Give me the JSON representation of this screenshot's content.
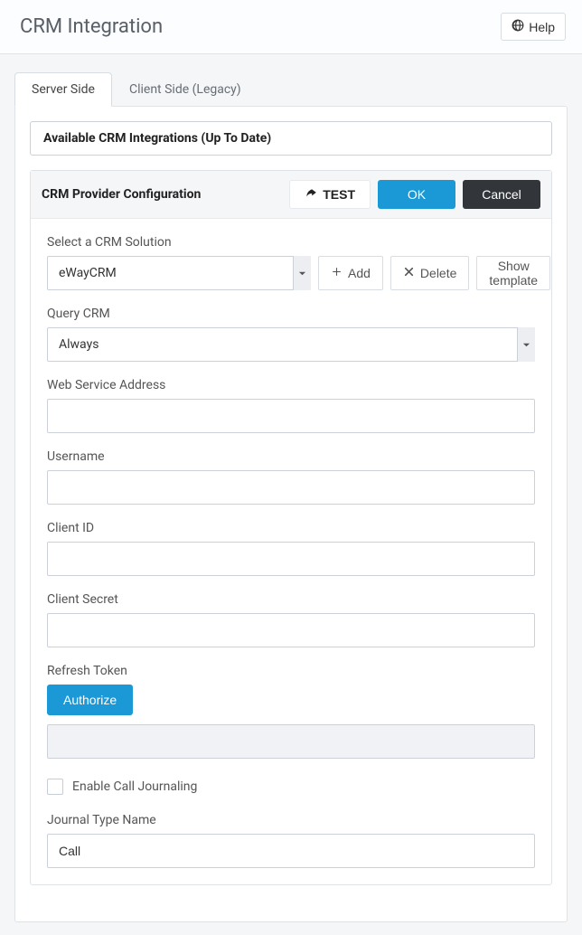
{
  "header": {
    "title": "CRM Integration",
    "help_label": "Help"
  },
  "tabs": {
    "server_side": "Server Side",
    "client_side": "Client Side (Legacy)"
  },
  "available_bar": "Available CRM Integrations (Up To Date)",
  "config": {
    "title": "CRM Provider Configuration",
    "test_label": "TEST",
    "ok_label": "OK",
    "cancel_label": "Cancel"
  },
  "fields": {
    "select_crm_label": "Select a CRM Solution",
    "crm_selected": "eWayCRM",
    "add_label": "Add",
    "delete_label": "Delete",
    "show_template_label": "Show template",
    "query_crm_label": "Query CRM",
    "query_crm_value": "Always",
    "web_service_label": "Web Service Address",
    "web_service_value": "",
    "username_label": "Username",
    "username_value": "",
    "client_id_label": "Client ID",
    "client_id_value": "",
    "client_secret_label": "Client Secret",
    "client_secret_value": "",
    "refresh_token_label": "Refresh Token",
    "authorize_label": "Authorize",
    "enable_journaling_label": "Enable Call Journaling",
    "journal_type_label": "Journal Type Name",
    "journal_type_value": "Call"
  }
}
